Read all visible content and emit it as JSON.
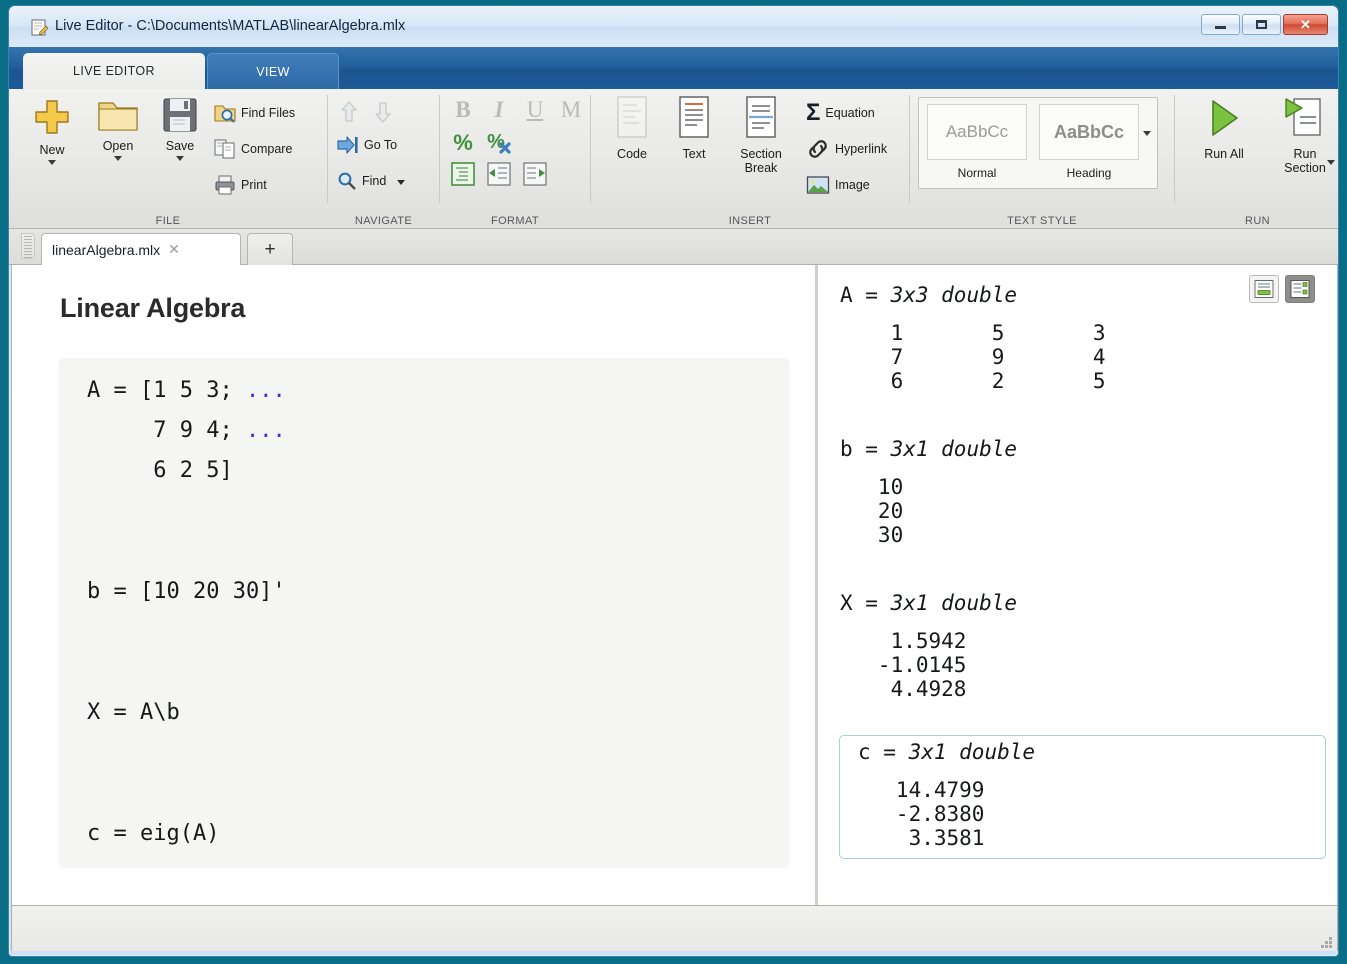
{
  "window": {
    "title": "Live Editor - C:\\Documents\\MATLAB\\linearAlgebra.mlx",
    "app_icon": "live-editor-icon",
    "minimize_label": "Minimize",
    "maximize_label": "Maximize",
    "close_label": "✕"
  },
  "ribbon_tabs": [
    {
      "label": "LIVE EDITOR",
      "active": true
    },
    {
      "label": "VIEW",
      "active": false
    }
  ],
  "quick_access": [
    {
      "name": "new-file-icon",
      "enabled": true
    },
    {
      "name": "save-icon",
      "enabled": true
    },
    {
      "name": "cut-icon",
      "enabled": false
    },
    {
      "name": "copy-icon",
      "enabled": false
    },
    {
      "name": "paste-icon",
      "enabled": true
    },
    {
      "name": "undo-icon",
      "enabled": false
    },
    {
      "name": "redo-icon",
      "enabled": false
    },
    {
      "name": "switch-windows-icon",
      "enabled": true
    },
    {
      "name": "help-icon",
      "enabled": true
    }
  ],
  "quick_access_right": [
    {
      "name": "customize-toolbar-icon"
    },
    {
      "name": "minimize-ribbon-icon"
    }
  ],
  "groups": {
    "file": {
      "label": "FILE",
      "new": "New",
      "open": "Open",
      "save": "Save",
      "find_files": "Find Files",
      "compare": "Compare",
      "print": "Print"
    },
    "navigate": {
      "label": "NAVIGATE",
      "go_to": "Go To",
      "find": "Find",
      "up": "Go Up",
      "down": "Go Down"
    },
    "format": {
      "label": "FORMAT",
      "bold": "B",
      "italic": "I",
      "underline": "U",
      "mono": "M",
      "comment": "comment-icon",
      "uncomment": "uncomment-icon",
      "smart_indent": "smart-indent-icon",
      "increase_indent": "increase-indent-icon",
      "decrease_indent": "decrease-indent-icon"
    },
    "insert": {
      "label": "INSERT",
      "code": "Code",
      "text": "Text",
      "section_break_line1": "Section",
      "section_break_line2": "Break",
      "equation": "Equation",
      "hyperlink": "Hyperlink",
      "image": "Image",
      "equation_glyph": "Σ"
    },
    "text_style": {
      "label": "TEXT STYLE",
      "normal_preview": "AaBbCc",
      "normal_name": "Normal",
      "heading_preview": "AaBbCc",
      "heading_name": "Heading",
      "more_label": "More styles"
    },
    "run": {
      "label": "RUN",
      "run_all": "Run All",
      "run_section_line1": "Run",
      "run_section_line2": "Section"
    }
  },
  "doc_tabs": {
    "tab_label": "linearAlgebra.mlx",
    "close_glyph": "✕",
    "new_tab_glyph": "+"
  },
  "document": {
    "heading": "Linear Algebra",
    "code_lines": [
      {
        "text": "A = [1 5 3; ",
        "cont": "..."
      },
      {
        "text": "     7 9 4; ",
        "cont": "..."
      },
      {
        "text": "     6 2 5]",
        "cont": ""
      },
      {
        "text": "b = [10 20 30]'",
        "cont": ""
      },
      {
        "text": "X = A\\b",
        "cont": ""
      },
      {
        "text": "c = eig(A)",
        "cont": ""
      }
    ]
  },
  "output": {
    "layout_toggles": [
      {
        "name": "output-inline-icon",
        "selected": false
      },
      {
        "name": "output-on-right-icon",
        "selected": true
      }
    ],
    "blocks": [
      {
        "name": "A",
        "eq": " = ",
        "type": "3x3 double",
        "rows": [
          "    1       5       3",
          "    7       9       4",
          "    6       2       5"
        ],
        "selected": false
      },
      {
        "name": "b",
        "eq": " = ",
        "type": "3x1 double",
        "rows": [
          "   10",
          "   20",
          "   30"
        ],
        "selected": false
      },
      {
        "name": "X",
        "eq": " = ",
        "type": "3x1 double",
        "rows": [
          "    1.5942",
          "   -1.0145",
          "    4.4928"
        ],
        "selected": false
      },
      {
        "name": "c",
        "eq": " = ",
        "type": "3x1 double",
        "rows": [
          "   14.4799",
          "   -2.8380",
          "    3.3581"
        ],
        "selected": true
      }
    ]
  },
  "colors": {
    "accent_blue": "#1d5590",
    "selection_border": "#a9cdea",
    "continuation": "#3b36c9",
    "code_bg": "#f5f5f4"
  }
}
